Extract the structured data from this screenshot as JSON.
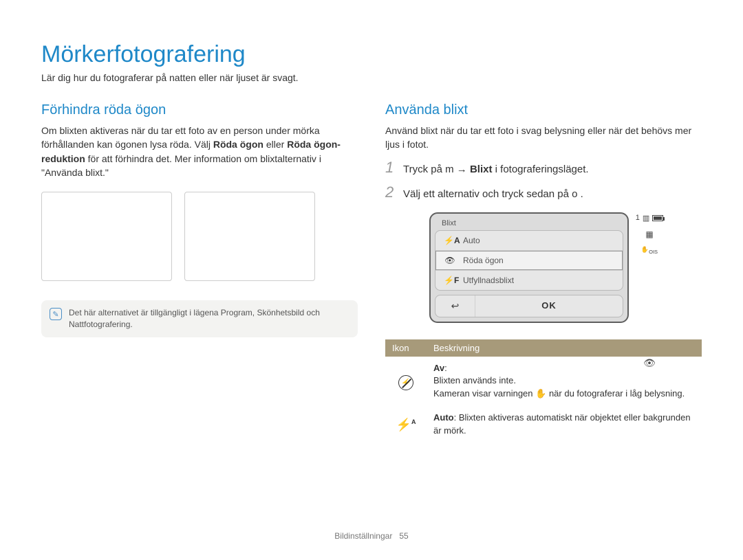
{
  "title": "Mörkerfotografering",
  "subtitle": "Lär dig hur du fotograferar på natten eller när ljuset är svagt.",
  "left": {
    "heading": "Förhindra röda ögon",
    "para": "Om blixten aktiveras när du tar ett foto av en person under mörka förhållanden kan ögonen lysa röda. Välj ",
    "opt1": "Röda ögon",
    "mid": " eller ",
    "opt2": "Röda ögon-reduktion",
    "tail": " för att förhindra det. Mer information om blixtalternativ i \"Använda blixt.\"",
    "note_icon": "✎",
    "note": "Det här alternativet är tillgängligt i lägena Program, Skönhetsbild och Nattfotografering."
  },
  "right": {
    "heading": "Använda blixt",
    "intro": "Använd blixt när du tar ett foto i svag belysning eller när det behövs mer ljus i fotot.",
    "step1_pre": "Tryck på ",
    "step1_m": "m",
    "step1_arrow": " → ",
    "step1_bold": "Blixt",
    "step1_post": " i fotograferingsläget.",
    "step2_pre": "Välj ett alternativ och tryck sedan på ",
    "step2_o": "o",
    "step2_post": "."
  },
  "camera": {
    "panel_label": "Blixt",
    "items": [
      {
        "icon": "⚡A",
        "label": "Auto"
      },
      {
        "icon": "👁",
        "label": "Röda ögon"
      },
      {
        "icon": "⚡F",
        "label": "Utfyllnadsblixt"
      }
    ],
    "back": "↩",
    "ok": "OK",
    "side_count": "1",
    "side_card": "▥"
  },
  "table": {
    "head_icon": "Ikon",
    "head_desc": "Beskrivning",
    "rows": [
      {
        "icon_type": "off",
        "title": "Av",
        "colon": ":",
        "line1": "Blixten används inte.",
        "line2a": "Kameran visar varningen ",
        "line2_icon": "✋",
        "line2b": " när du fotograferar i låg belysning."
      },
      {
        "icon_type": "auto",
        "title": "Auto",
        "colon": ": ",
        "line1": "Blixten aktiveras automatiskt när objektet eller bakgrunden är mörk."
      }
    ]
  },
  "footer": {
    "section": "Bildinställningar",
    "page": "55"
  }
}
